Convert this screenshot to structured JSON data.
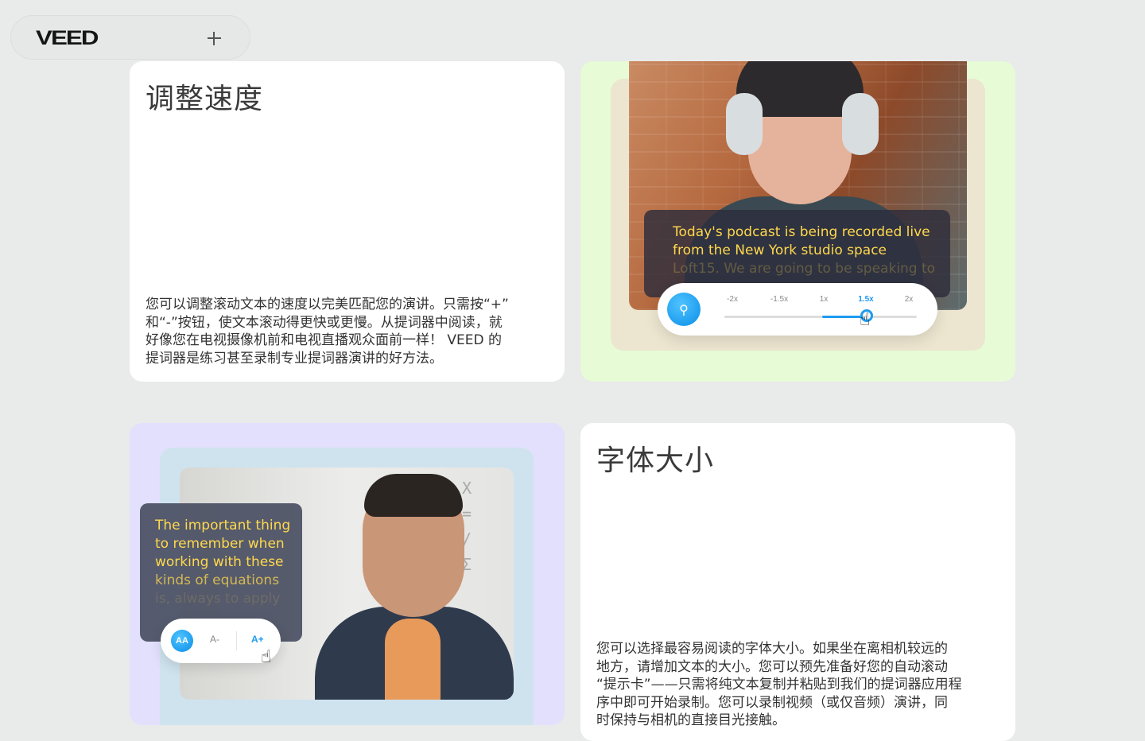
{
  "header": {
    "logo": "VEED",
    "add_icon": "plus-icon"
  },
  "cards": {
    "speed": {
      "title": "调整速度",
      "desc": [
        "您可以调整滚动文本的速度以完美匹配您的演讲。只需按“+”",
        "和“-”按钮，使文本滚动得更快或更慢。从提词器中阅读，就",
        "好像您在电视摄像机前和电视直播观众面前一样！ VEED 的",
        "提词器是练习甚至录制专业提词器演讲的好方法。"
      ]
    },
    "font": {
      "title": "字体大小",
      "desc": [
        "您可以选择最容易阅读的字体大小。如果坐在离相机较远的",
        "地方，请增加文本的大小。您可以预先准备好您的自动滚动",
        "“提示卡”——只需将纯文本复制并粘贴到我们的提词器应用程",
        "序中即可开始录制。您可以录制视频（或仅音频）演讲，同",
        "时保持与相机的直接目光接触。"
      ]
    }
  },
  "speed_demo": {
    "caption": [
      "Today's podcast is being recorded live",
      "from the New York studio space",
      "Loft15. We are going to be speaking to"
    ],
    "ticks": [
      "-2x",
      "-1.5x",
      "1x",
      "1.5x",
      "2x"
    ],
    "selected": "1.5x",
    "icon": "speedometer-icon",
    "accent": "#1e9bf0"
  },
  "font_demo": {
    "caption": [
      "The important thing",
      "to remember when",
      "working with these",
      "kinds of equations",
      "is, always to apply"
    ],
    "aa_label": "AA",
    "minus_label": "A-",
    "plus_label": "A+",
    "icon": "font-size-icon"
  }
}
